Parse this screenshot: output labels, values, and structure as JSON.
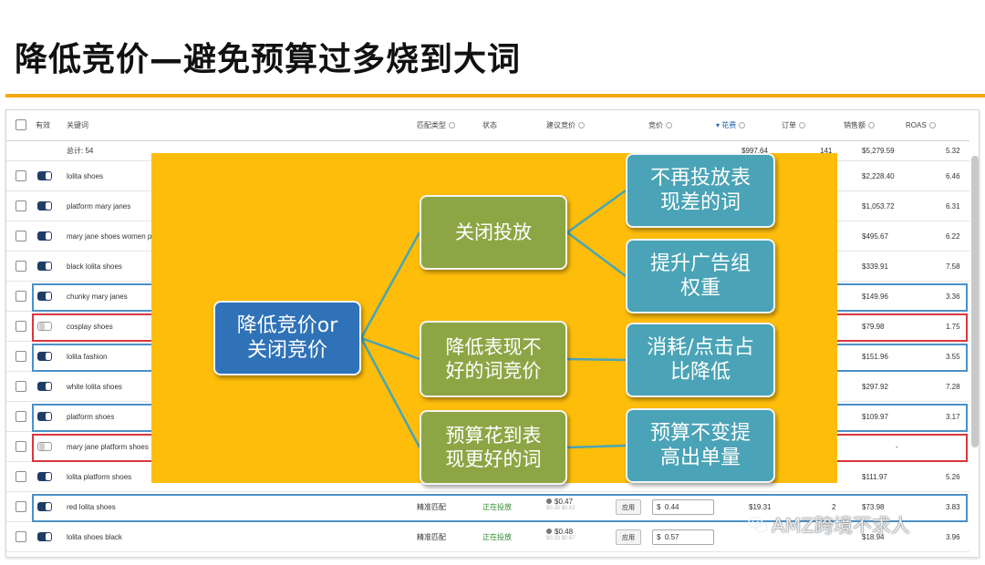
{
  "slide": {
    "title": "降低竞价—避免预算过多烧到大词"
  },
  "table": {
    "headers": {
      "active": "有效",
      "keyword": "关键词",
      "match_type": "匹配类型",
      "status": "状态",
      "suggested_bid": "建议竞价",
      "bid": "竞价",
      "spend": "▾ 花费",
      "orders": "订单",
      "sales": "销售额",
      "roas": "ROAS"
    },
    "totals": {
      "label": "总计: 54",
      "spend": "$997.64",
      "orders": "141",
      "sales": "$5,279.59",
      "roas": "5.32"
    },
    "rows": [
      {
        "keyword": "lolita shoes",
        "toggle": "on",
        "sales": "$2,228.40",
        "roas": "6.46"
      },
      {
        "keyword": "platform mary janes",
        "toggle": "on",
        "sales": "$1,053.72",
        "roas": "6.31"
      },
      {
        "keyword": "mary jane shoes women p",
        "toggle": "on",
        "sales": "$495.67",
        "roas": "6.22"
      },
      {
        "keyword": "black lolita shoes",
        "toggle": "on",
        "sales": "$339.91",
        "roas": "7.58"
      },
      {
        "keyword": "chunky mary janes",
        "toggle": "on",
        "sales": "$149.96",
        "roas": "3.36"
      },
      {
        "keyword": "cosplay shoes",
        "toggle": "off",
        "sales": "$79.98",
        "roas": "1.75"
      },
      {
        "keyword": "lolita fashion",
        "toggle": "on",
        "sales": "$151.96",
        "roas": "3.55"
      },
      {
        "keyword": "white lolita shoes",
        "toggle": "on",
        "sales": "$297.92",
        "roas": "7.28"
      },
      {
        "keyword": "platform shoes",
        "toggle": "on",
        "sales": "$109.97",
        "roas": "3.17"
      },
      {
        "keyword": "mary jane platform shoes",
        "toggle": "off",
        "sales": "-",
        "roas": ""
      },
      {
        "keyword": "lolita platform shoes",
        "toggle": "on",
        "sales": "$111.97",
        "roas": "5.26"
      },
      {
        "keyword": "red lolita shoes",
        "toggle": "on",
        "match": "精准匹配",
        "status": "正在投放",
        "suggested": "$0.47",
        "suggested_range": "$0.30 $0.62",
        "apply": "应用",
        "bid_currency": "$",
        "bid": "0.44",
        "spend": "$19.31",
        "orders": "2",
        "sales": "$73.98",
        "roas": "3.83"
      },
      {
        "keyword": "lolita shoes black",
        "toggle": "on",
        "match": "精准匹配",
        "status": "正在投放",
        "suggested": "$0.48",
        "suggested_range": "$0.33 $0.67",
        "apply": "应用",
        "bid_currency": "$",
        "bid": "0.57",
        "spend": "",
        "orders": "",
        "sales": "$18.94",
        "roas": "3.96"
      }
    ]
  },
  "mindmap": {
    "root": "降低竞价or\n关闭竞价",
    "branches": [
      {
        "label": "关闭投放",
        "leaves": [
          "不再投放表\n现差的词",
          "提升广告组\n权重"
        ]
      },
      {
        "label": "降低表现不\n好的词竞价",
        "leaves": [
          "消耗/点击占\n比降低"
        ]
      },
      {
        "label": "预算花到表\n现更好的词",
        "leaves": [
          "预算不变提\n高出单量"
        ]
      }
    ]
  },
  "watermark": {
    "icon": "wechat-icon",
    "text": "AMZ跨境不求人"
  },
  "colors": {
    "accent_rule": "#f3a712",
    "overlay_bg": "#fdbd0a",
    "root_node": "#2f72b7",
    "branch_node": "#8da645",
    "leaf_node": "#4aa3b6",
    "connector": "#49a5b6",
    "highlight_blue": "#4a90c8",
    "highlight_red": "#d9363e"
  }
}
